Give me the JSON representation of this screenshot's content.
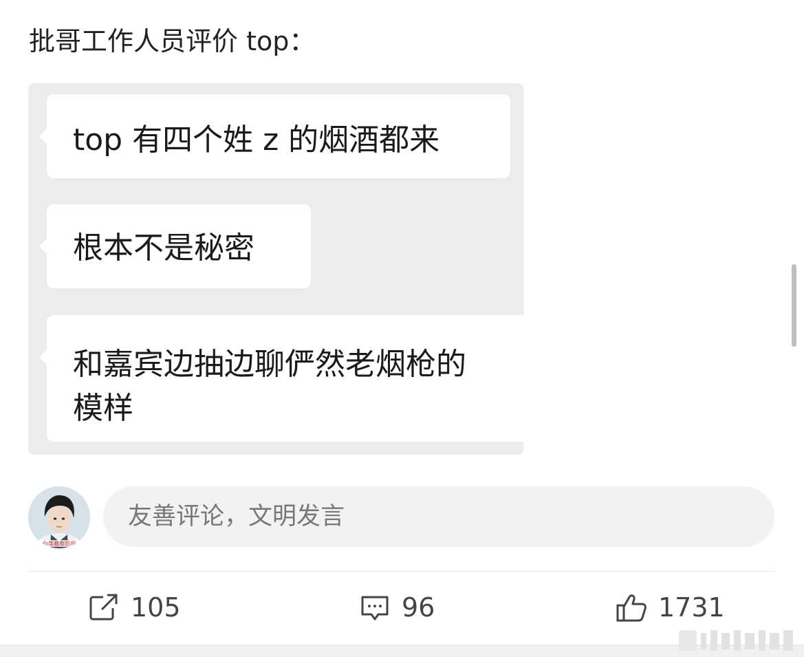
{
  "post": {
    "title": "批哥工作人员评价 top："
  },
  "chat": {
    "messages": [
      {
        "text": "top 有四个姓 z 的烟酒都来"
      },
      {
        "text": "根本不是秘密"
      },
      {
        "lines": [
          "和嘉宾边抽边聊俨然老烟枪的",
          "模样"
        ]
      }
    ]
  },
  "avatar": {
    "caption": "你等着寿司吧"
  },
  "comment": {
    "placeholder": "友善评论，文明发言"
  },
  "actions": {
    "repost": {
      "icon": "share-icon",
      "count": "105"
    },
    "comment": {
      "icon": "comment-icon",
      "count": "96"
    },
    "like": {
      "icon": "thumbs-up-icon",
      "count": "1731"
    }
  }
}
